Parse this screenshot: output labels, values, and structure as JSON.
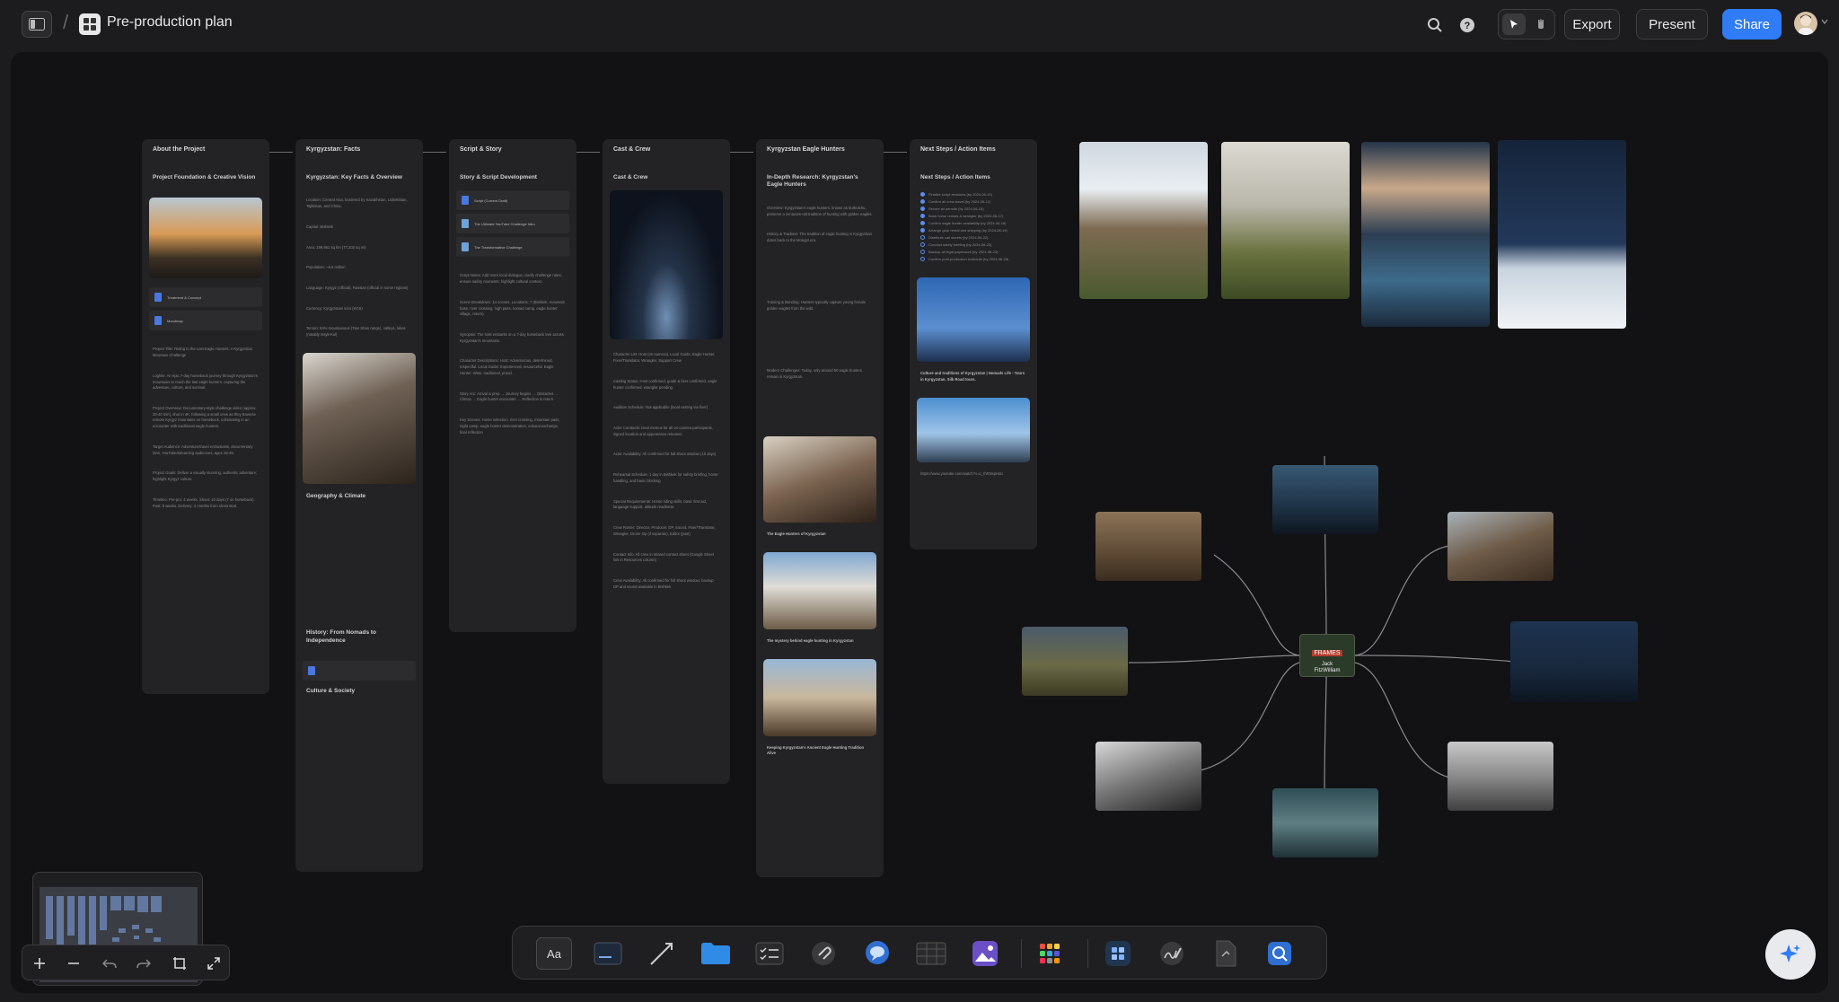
{
  "header": {
    "title": "Pre-production plan",
    "export_label": "Export",
    "present_label": "Present",
    "share_label": "Share"
  },
  "colors": {
    "accent": "#2f7cf6",
    "canvas": "#121214",
    "card": "#232325"
  },
  "columns": [
    {
      "title": "About the Project",
      "heading": "Project Foundation & Creative Vision",
      "files": [
        "Treatment & Concept",
        "Moodmap"
      ],
      "texts": [
        "Project Title: Riding to the Last Eagle Hunters: A Kyrgyzstan Mountain Challenge",
        "Logline: An epic 7-day horseback journey through Kyrgyzstan's mountains to reach the last eagle hunters, capturing the adventure, culture, and survival.",
        "Project Overview: Documentary-style challenge video (approx. 30-40 min), shot in 4K, following a small crew as they traverse remote Kyrgyz mountains on horseback, culminating in an encounter with traditional eagle hunters.",
        "Target Audience: Adventure/travel enthusiasts, documentary fans, YouTube/streaming audiences, ages 18-45.",
        "Project Goals: Deliver a visually stunning, authentic adventure; highlight Kyrgyz culture.",
        "Timeline: Pre-pro: 4 weeks. Shoot: 10 days (7 on horseback). Post: 8 weeks. Delivery: 3 months from shoot start."
      ]
    },
    {
      "title": "Kyrgyzstan: Facts",
      "heading": "Kyrgyzstan: Key Facts & Overview",
      "texts": [
        "Location: Central Asia, bordered by Kazakhstan, Uzbekistan, Tajikistan, and China.",
        "Capital: Bishkek",
        "Area: 199,951 sq km (77,202 sq mi)",
        "Population: ~6.5 million",
        "Language: Kyrgyz (official), Russian (official in some regions)",
        "Currency: Kyrgyzstani som (KGS)",
        "Terrain: 94% mountainous (Tian Shan range), valleys, lakes (notably Issyk-Kul)"
      ],
      "sections": [
        "Geography & Climate",
        "History: From Nomads to Independence",
        "Culture & Society"
      ]
    },
    {
      "title": "Script & Story",
      "heading": "Story & Script Development",
      "files": [
        "Script (Current Draft)",
        "The Ultimate YouTube Challenge Intro",
        "The Transformative Challenge"
      ],
      "texts": [
        "Script Notes: Add more local dialogue; clarify challenge rules; ensure safety moments; highlight cultural context.",
        "Scene Breakdown: 14 scenes. Locations: 7 (Bishkek, mountain base, river crossing, high pass, nomad camp, eagle hunter village, return).",
        "Synopsis: The host embarks on a 7-day horseback trek across Kyrgyzstan's mountains.",
        "Character Descriptions: Host: Adventurous, determined, respectful. Local Guide: Experienced, resourceful. Eagle Hunter: Wise, traditional, proud.",
        "Story Arc: Arrival & prep → Journey begins → Obstacles → Climax → Eagle hunter encounter → Reflection & return",
        "Key Scenes: Horse selection, river crossing, mountain pass, night camp, eagle hunter demonstration, cultural exchange, final reflection"
      ]
    },
    {
      "title": "Cast & Crew",
      "heading": "Cast & Crew",
      "texts": [
        "Character List: Host (on-camera), Local Guide, Eagle Hunter, Fixer/Translator, Wrangler, Support Crew",
        "Casting Status: Host confirmed, guide & fixer confirmed, eagle hunter confirmed, wrangler pending",
        "Audition Schedule: Not applicable (local casting via fixer)",
        "Actor Contracts: Deal memos for all on-camera participants, signed location and appearance releases",
        "Actor Availability: All confirmed for full shoot window (10 days)",
        "Rehearsal Schedule: 1 day in Bishkek for safety briefing, horse handling, and basic blocking",
        "Special Requirements: Horse riding skills, basic first aid, language support, altitude readiness",
        "Crew Roster: Director, Producer, DP, Sound, Fixer/Translator, Wrangler, Drone Op (if separate), Editor (post)",
        "Contact Info: All crew in shared contact sheet (Google Sheet link in Resources column)",
        "Crew Availability: All confirmed for full shoot window; backup DP and sound available in Bishkek"
      ]
    },
    {
      "title": "Kyrgyzstan Eagle Hunters",
      "heading": "In-Depth Research: Kyrgyzstan's Eagle Hunters",
      "texts": [
        "Overview: Kyrgyzstan's eagle hunters, known as burkutchu, preserve a centuries-old tradition of hunting with golden eagles.",
        "History & Tradition: The tradition of eagle hunting in Kyrgyzstan dates back to the Mongol era.",
        "Training & Bonding: Hunters typically capture young female golden eagles from the wild.",
        "Modern Challenges: Today, only around 50 eagle hunters remain in Kyrgyzstan."
      ],
      "links": [
        "The Eagle Hunters of Kyrgyzstan",
        "The mystery behind eagle hunting in Kyrgyzstan",
        "Keeping Kyrgyzstan's Ancient Eagle Hunting Tradition Alive"
      ]
    },
    {
      "title": "Next Steps / Action Items",
      "heading": "Next Steps / Action Items",
      "tasks": [
        "Finalize script revisions (by 2024-06-10)",
        "Confirm all crew travel (by 2024-06-12)",
        "Secure all permits (by 2024-06-15)",
        "Book horse rentals & wrangler (by 2024-06-17)",
        "Confirm eagle hunter availability (by 2024-06-18)",
        "Arrange gear rental and shipping (by 2024-06-19)",
        "Distribute call sheets (by 2024-06-22)",
        "Conduct safety briefing (by 2024-06-23)",
        "Backup all legal paperwork (by 2024-06-24)",
        "Confirm post-production schedule (by 2024-06-25)"
      ],
      "links": [
        "Culture and traditions of Kyrgyzstan | Nomads Life - Tours in Kyrgyzstan. Silk Road tours.",
        "https://www.youtube.com/watch?v=L_IhRNxpHdo"
      ]
    }
  ],
  "hub": {
    "line1": "FRAMES",
    "line2": "Jack",
    "line3": "FitzWilliam"
  },
  "dock_tools": [
    "Aa"
  ]
}
